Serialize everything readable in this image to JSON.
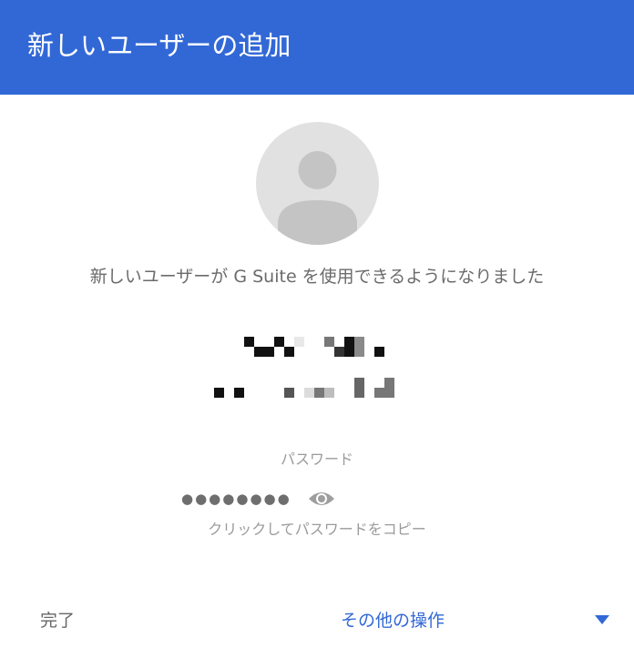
{
  "header": {
    "title": "新しいユーザーの追加"
  },
  "avatar": {
    "icon": "person-icon"
  },
  "message": {
    "success": "新しいユーザーが G Suite を使用できるようになりました"
  },
  "password": {
    "label": "パスワード",
    "masked_value": "●●●●●●●●",
    "visibility_icon": "eye-icon",
    "copy_hint": "クリックしてパスワードをコピー"
  },
  "footer": {
    "done_label": "完了",
    "more_actions_label": "その他の操作",
    "dropdown_icon": "caret-down-icon"
  },
  "colors": {
    "brand": "#3268d6",
    "avatar_bg": "#e1e1e1",
    "avatar_fg": "#c4c4c4"
  }
}
